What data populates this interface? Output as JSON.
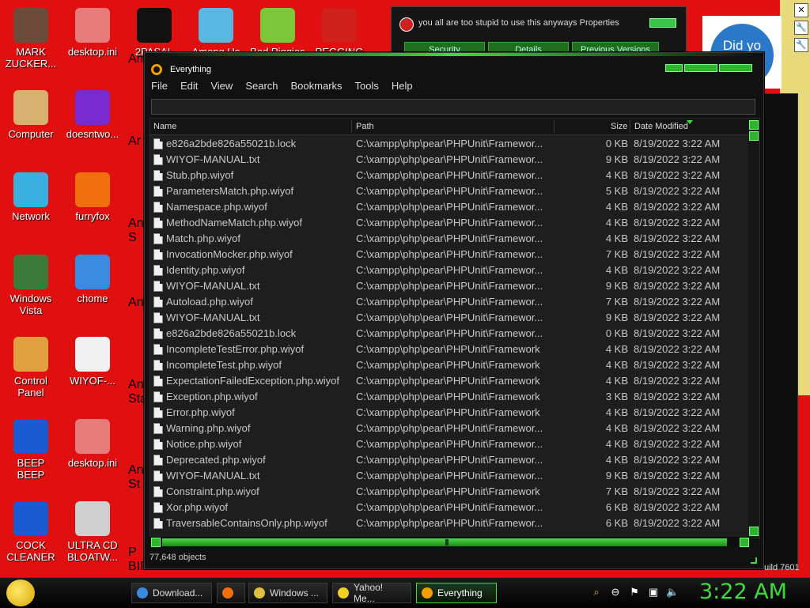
{
  "desktop": {
    "icons": [
      {
        "label": "MARK\nZUCKER...",
        "color": "#6b4c3b"
      },
      {
        "label": "desktop.ini",
        "color": "#e87a7a"
      },
      {
        "label": "2PASAL\n2...",
        "color": "#111111"
      },
      {
        "label": "Among Us",
        "color": "#5ab8e0"
      },
      {
        "label": "Bad Piggies",
        "color": "#7ac83a"
      },
      {
        "label": "PEGGING",
        "color": "#d0201a"
      },
      {
        "label": "Computer",
        "color": "#d8b070"
      },
      {
        "label": "doesntwo...",
        "color": "#7a2ad0"
      },
      {
        "label": "Network",
        "color": "#3ab0e0"
      },
      {
        "label": "furryfox",
        "color": "#f07010"
      },
      {
        "label": "Windows\nVista",
        "color": "#3a7a3a"
      },
      {
        "label": "chome",
        "color": "#3a8ae0"
      },
      {
        "label": "Control\nPanel",
        "color": "#e0a040"
      },
      {
        "label": "WIYOF-...",
        "color": "#f0f0f0"
      },
      {
        "label": "BEEP\nBEEP",
        "color": "#1a5ad0"
      },
      {
        "label": "desktop.ini",
        "color": "#e87a7a"
      },
      {
        "label": "COCK\nCLEANER",
        "color": "#1a5ad0"
      },
      {
        "label": "ULTRA CD\nBLOATW...",
        "color": "#d0d0d0"
      }
    ],
    "partial_labels": [
      "Am",
      "Ar",
      "An\nS",
      "An",
      "An\nSta",
      "An\nSt",
      "P\nBIR"
    ]
  },
  "props_window": {
    "title": "you all are too stupid to use this anyways Properties",
    "tabs": [
      "Security",
      "Details",
      "Previous Versions"
    ]
  },
  "card_text": "Did yo",
  "everything": {
    "title": "Everything",
    "menu": [
      "File",
      "Edit",
      "View",
      "Search",
      "Bookmarks",
      "Tools",
      "Help"
    ],
    "search_value": "",
    "columns": {
      "name": "Name",
      "path": "Path",
      "size": "Size",
      "date": "Date Modified"
    },
    "rows": [
      {
        "name": "e826a2bde826a55021b.lock",
        "path": "C:\\xampp\\php\\pear\\PHPUnit\\Framewor...",
        "size": "0 KB",
        "date": "8/19/2022 3:22 AM"
      },
      {
        "name": "WIYOF-MANUAL.txt",
        "path": "C:\\xampp\\php\\pear\\PHPUnit\\Framewor...",
        "size": "9 KB",
        "date": "8/19/2022 3:22 AM"
      },
      {
        "name": "Stub.php.wiyof",
        "path": "C:\\xampp\\php\\pear\\PHPUnit\\Framewor...",
        "size": "4 KB",
        "date": "8/19/2022 3:22 AM"
      },
      {
        "name": "ParametersMatch.php.wiyof",
        "path": "C:\\xampp\\php\\pear\\PHPUnit\\Framewor...",
        "size": "5 KB",
        "date": "8/19/2022 3:22 AM"
      },
      {
        "name": "Namespace.php.wiyof",
        "path": "C:\\xampp\\php\\pear\\PHPUnit\\Framewor...",
        "size": "4 KB",
        "date": "8/19/2022 3:22 AM"
      },
      {
        "name": "MethodNameMatch.php.wiyof",
        "path": "C:\\xampp\\php\\pear\\PHPUnit\\Framewor...",
        "size": "4 KB",
        "date": "8/19/2022 3:22 AM"
      },
      {
        "name": "Match.php.wiyof",
        "path": "C:\\xampp\\php\\pear\\PHPUnit\\Framewor...",
        "size": "4 KB",
        "date": "8/19/2022 3:22 AM"
      },
      {
        "name": "InvocationMocker.php.wiyof",
        "path": "C:\\xampp\\php\\pear\\PHPUnit\\Framewor...",
        "size": "7 KB",
        "date": "8/19/2022 3:22 AM"
      },
      {
        "name": "Identity.php.wiyof",
        "path": "C:\\xampp\\php\\pear\\PHPUnit\\Framewor...",
        "size": "4 KB",
        "date": "8/19/2022 3:22 AM"
      },
      {
        "name": "WIYOF-MANUAL.txt",
        "path": "C:\\xampp\\php\\pear\\PHPUnit\\Framewor...",
        "size": "9 KB",
        "date": "8/19/2022 3:22 AM"
      },
      {
        "name": "Autoload.php.wiyof",
        "path": "C:\\xampp\\php\\pear\\PHPUnit\\Framewor...",
        "size": "7 KB",
        "date": "8/19/2022 3:22 AM"
      },
      {
        "name": "WIYOF-MANUAL.txt",
        "path": "C:\\xampp\\php\\pear\\PHPUnit\\Framewor...",
        "size": "9 KB",
        "date": "8/19/2022 3:22 AM"
      },
      {
        "name": "e826a2bde826a55021b.lock",
        "path": "C:\\xampp\\php\\pear\\PHPUnit\\Framewor...",
        "size": "0 KB",
        "date": "8/19/2022 3:22 AM"
      },
      {
        "name": "IncompleteTestError.php.wiyof",
        "path": "C:\\xampp\\php\\pear\\PHPUnit\\Framework",
        "size": "4 KB",
        "date": "8/19/2022 3:22 AM"
      },
      {
        "name": "IncompleteTest.php.wiyof",
        "path": "C:\\xampp\\php\\pear\\PHPUnit\\Framework",
        "size": "4 KB",
        "date": "8/19/2022 3:22 AM"
      },
      {
        "name": "ExpectationFailedException.php.wiyof",
        "path": "C:\\xampp\\php\\pear\\PHPUnit\\Framework",
        "size": "4 KB",
        "date": "8/19/2022 3:22 AM"
      },
      {
        "name": "Exception.php.wiyof",
        "path": "C:\\xampp\\php\\pear\\PHPUnit\\Framework",
        "size": "3 KB",
        "date": "8/19/2022 3:22 AM"
      },
      {
        "name": "Error.php.wiyof",
        "path": "C:\\xampp\\php\\pear\\PHPUnit\\Framework",
        "size": "4 KB",
        "date": "8/19/2022 3:22 AM"
      },
      {
        "name": "Warning.php.wiyof",
        "path": "C:\\xampp\\php\\pear\\PHPUnit\\Framewor...",
        "size": "4 KB",
        "date": "8/19/2022 3:22 AM"
      },
      {
        "name": "Notice.php.wiyof",
        "path": "C:\\xampp\\php\\pear\\PHPUnit\\Framewor...",
        "size": "4 KB",
        "date": "8/19/2022 3:22 AM"
      },
      {
        "name": "Deprecated.php.wiyof",
        "path": "C:\\xampp\\php\\pear\\PHPUnit\\Framewor...",
        "size": "4 KB",
        "date": "8/19/2022 3:22 AM"
      },
      {
        "name": "WIYOF-MANUAL.txt",
        "path": "C:\\xampp\\php\\pear\\PHPUnit\\Framewor...",
        "size": "9 KB",
        "date": "8/19/2022 3:22 AM"
      },
      {
        "name": "Constraint.php.wiyof",
        "path": "C:\\xampp\\php\\pear\\PHPUnit\\Framework",
        "size": "7 KB",
        "date": "8/19/2022 3:22 AM"
      },
      {
        "name": "Xor.php.wiyof",
        "path": "C:\\xampp\\php\\pear\\PHPUnit\\Framewor...",
        "size": "6 KB",
        "date": "8/19/2022 3:22 AM"
      },
      {
        "name": "TraversableContainsOnly.php.wiyof",
        "path": "C:\\xampp\\php\\pear\\PHPUnit\\Framewor...",
        "size": "6 KB",
        "date": "8/19/2022 3:22 AM"
      }
    ],
    "status": "77,648 objects"
  },
  "build_text": "uild 7601",
  "taskbar": {
    "tasks": [
      {
        "label": "Download...",
        "icon": "chrome-icon",
        "color": "#3a8ae0"
      },
      {
        "label": "",
        "icon": "firefox-icon",
        "color": "#f07010"
      },
      {
        "label": "Windows ...",
        "icon": "folder-icon",
        "color": "#e0c040"
      },
      {
        "label": "Yahoo! Me...",
        "icon": "yahoo-messenger-icon",
        "color": "#f0d020"
      },
      {
        "label": "Everything",
        "icon": "everything-icon",
        "color": "#f0a000"
      }
    ],
    "clock": "3:22 AM"
  },
  "colors": {
    "accent": "#3cdc3c",
    "desktop": "#e01010"
  }
}
